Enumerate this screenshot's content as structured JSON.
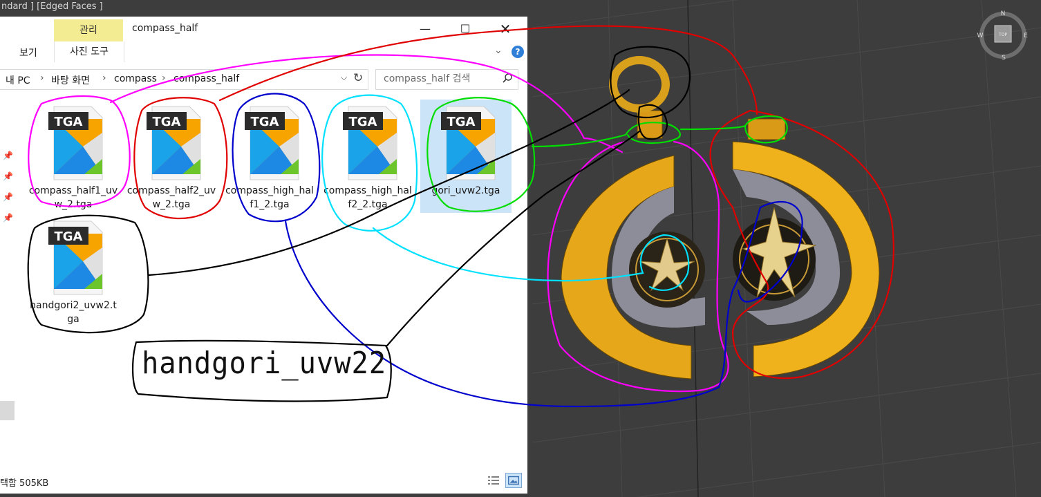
{
  "viewport": {
    "label": "ndard ] [Edged Faces ]",
    "viewcube": {
      "top": "TOP",
      "n": "N",
      "e": "E",
      "s": "S",
      "w": "W"
    }
  },
  "window": {
    "manage_tab": "관리",
    "title": "compass_half",
    "ribbon": {
      "view_tab": "보기",
      "picture_tools_tab": "사진 도구"
    },
    "breadcrumb": [
      "내 PC",
      "바탕 화면",
      "compass",
      "compass_half"
    ],
    "search_placeholder": "compass_half 검색",
    "files": [
      {
        "name": "compass_half1_uvw_2.tga",
        "icon_label": "TGA",
        "selected": false
      },
      {
        "name": "compass_half2_uvw_2.tga",
        "icon_label": "TGA",
        "selected": false
      },
      {
        "name": "compass_high_half1_2.tga",
        "icon_label": "TGA",
        "selected": false
      },
      {
        "name": "compass_high_half2_2.tga",
        "icon_label": "TGA",
        "selected": false
      },
      {
        "name": "gori_uvw2.tga",
        "icon_label": "TGA",
        "selected": true
      },
      {
        "name": "handgori2_uvw2.tga",
        "icon_label": "TGA",
        "selected": false
      }
    ],
    "status": "택함 505KB"
  },
  "annotation": {
    "handwritten_text": "handgori_uvw22",
    "colors": {
      "magenta": "#ff00ff",
      "red": "#e00000",
      "blue": "#0000cc",
      "cyan": "#00e0ff",
      "green": "#00dd00",
      "black": "#000000"
    }
  }
}
